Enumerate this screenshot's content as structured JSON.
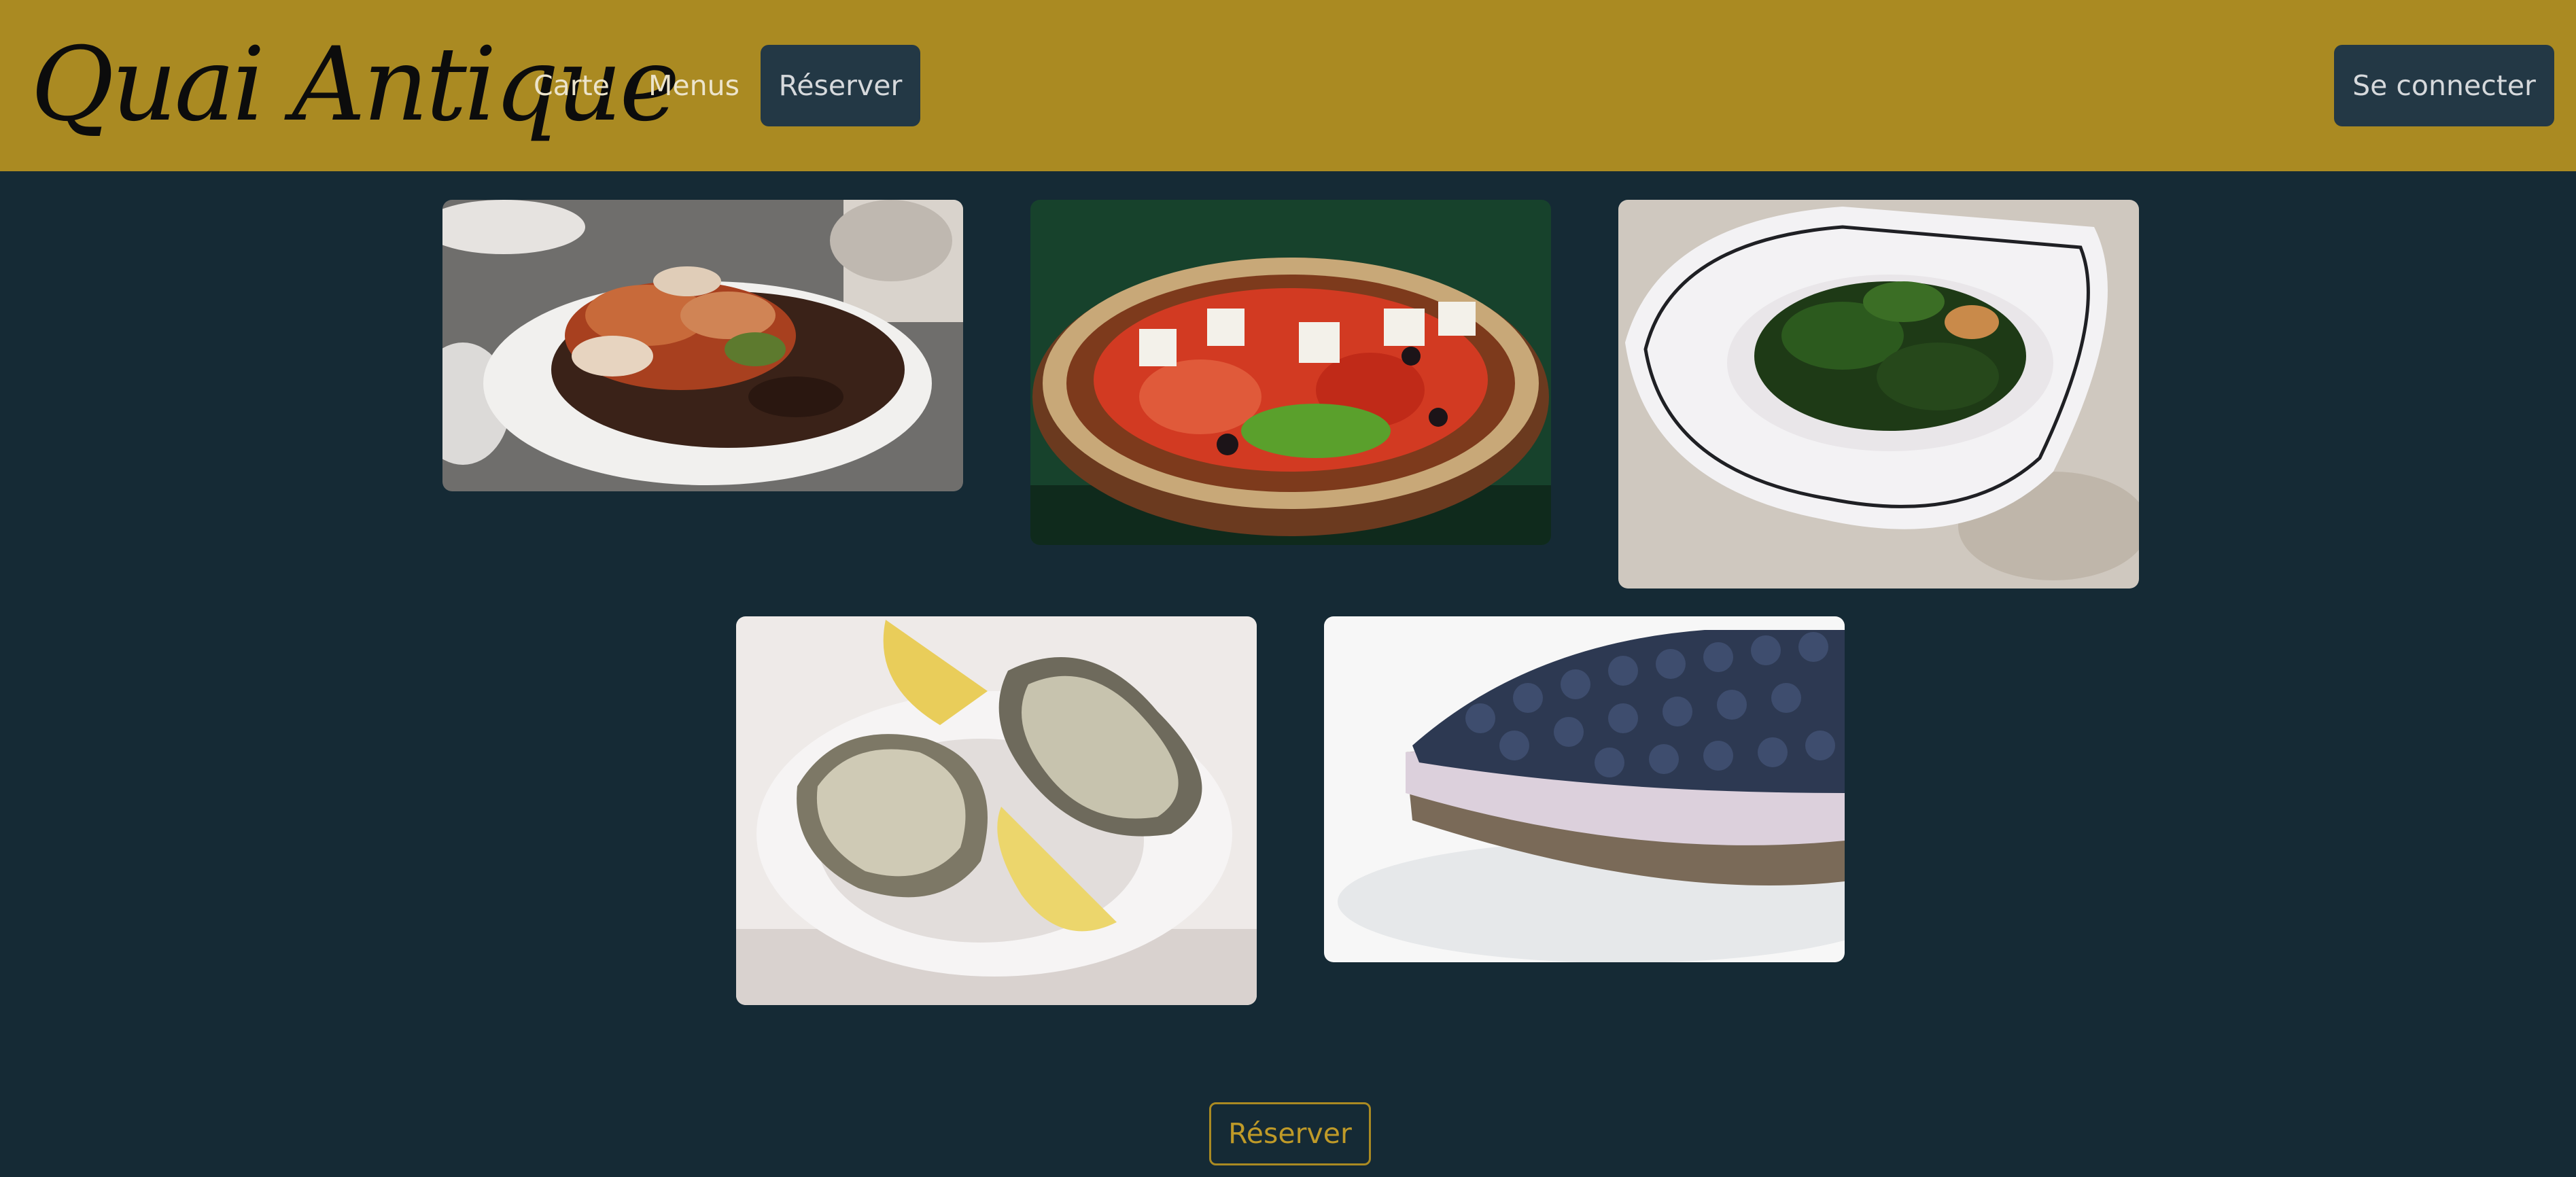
{
  "header": {
    "logo": "Quai Antique",
    "nav": {
      "carte": "Carte",
      "menus": "Menus",
      "reserver": "Réserver"
    },
    "login_label": "Se connecter"
  },
  "gallery": {
    "images": [
      {
        "icon": "seafood-platter-photo"
      },
      {
        "icon": "greek-salad-photo"
      },
      {
        "icon": "spinach-dish-photo"
      },
      {
        "icon": "oysters-lemon-photo"
      },
      {
        "icon": "blueberry-cheesecake-photo"
      }
    ]
  },
  "cta": {
    "reserver_label": "Réserver"
  },
  "colors": {
    "header_bg": "#aa8a22",
    "page_bg": "#152a35",
    "button_dark": "#233845",
    "accent": "#aa8a22"
  }
}
